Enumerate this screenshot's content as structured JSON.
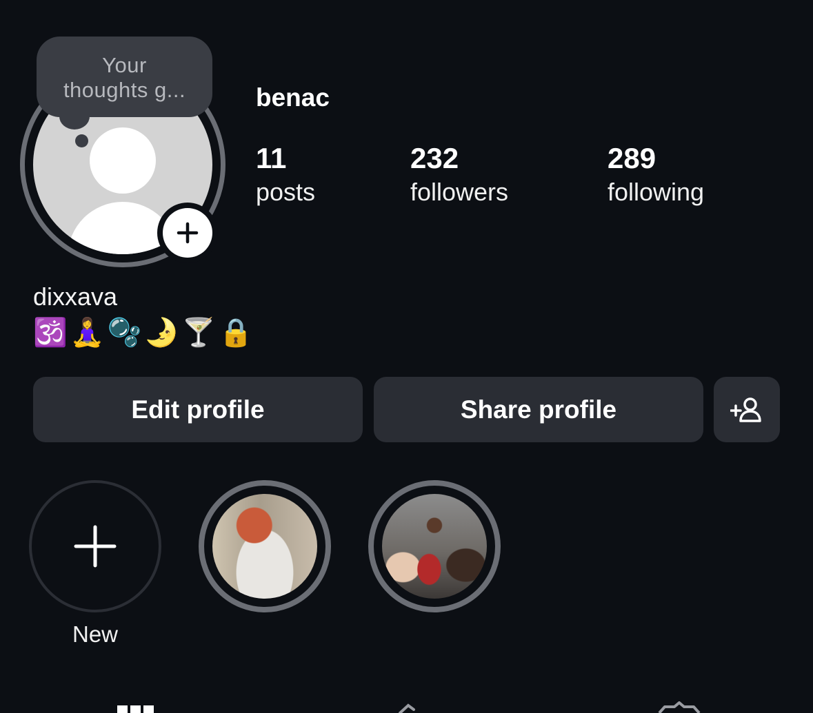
{
  "note": {
    "text": "Your\nthoughts g..."
  },
  "profile": {
    "username": "benac",
    "display_name": "dixxava",
    "bio": "🕉️🧘‍♀️🫧🌛🍸🔒"
  },
  "stats": [
    {
      "value": "11",
      "label": "posts"
    },
    {
      "value": "232",
      "label": "followers"
    },
    {
      "value": "289",
      "label": "following"
    }
  ],
  "actions": {
    "edit_label": "Edit profile",
    "share_label": "Share profile",
    "add_friend_icon": "add-person-icon"
  },
  "highlights": {
    "new_label": "New",
    "items": [
      {
        "icon": "story-image"
      },
      {
        "icon": "story-image"
      }
    ]
  },
  "tabs": [
    "grid-icon",
    "reels-icon",
    "tagged-icon"
  ]
}
